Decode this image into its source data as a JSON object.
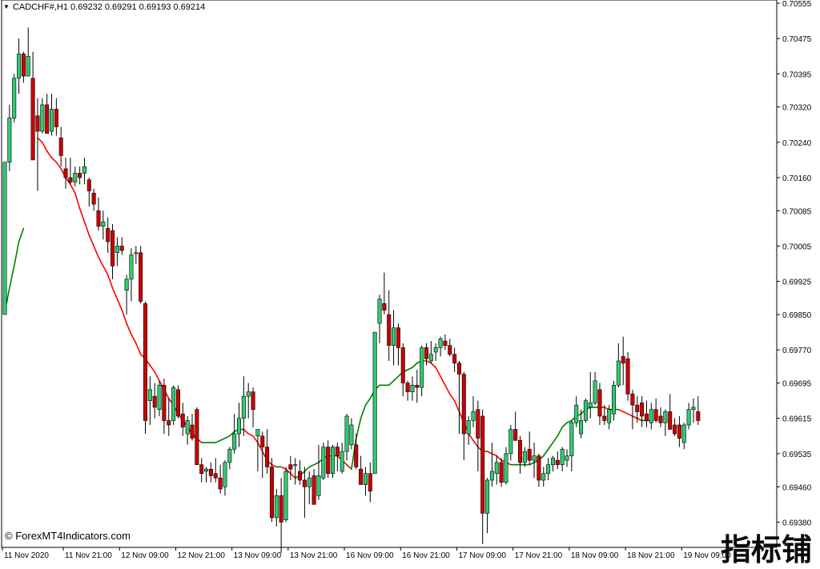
{
  "header": {
    "symbol_line": "CADCHF#,H1  0.69232 0.69291 0.69193 0.69214",
    "dropdown_icon": "triangle-down-icon"
  },
  "footer": {
    "copyright": "© ForexMT4Indicators.com",
    "watermark": "指标铺"
  },
  "colors": {
    "bull_candle": "#2ecc71",
    "bear_candle": "#cc0000",
    "wick": "#000000",
    "ma_up": "#008000",
    "ma_down": "#ff0000",
    "axis": "#000000",
    "background": "#ffffff"
  },
  "chart_data": {
    "type": "candlestick",
    "symbol": "CADCHF#",
    "timeframe": "H1",
    "ylim": [
      0.6933,
      0.70555
    ],
    "y_ticks": [
      "0.70555",
      "0.70475",
      "0.70395",
      "0.70320",
      "0.70240",
      "0.70160",
      "0.70085",
      "0.70005",
      "0.69925",
      "0.69850",
      "0.69770",
      "0.69695",
      "0.69615",
      "0.69535",
      "0.69460",
      "0.69380"
    ],
    "x_ticks": [
      {
        "label": "11 Nov 2020",
        "index": 0
      },
      {
        "label": "11 Nov 21:00",
        "index": 13
      },
      {
        "label": "12 Nov 09:00",
        "index": 25
      },
      {
        "label": "12 Nov 21:00",
        "index": 37
      },
      {
        "label": "13 Nov 09:00",
        "index": 49
      },
      {
        "label": "13 Nov 21:00",
        "index": 61
      },
      {
        "label": "16 Nov 09:00",
        "index": 73
      },
      {
        "label": "16 Nov 21:00",
        "index": 85
      },
      {
        "label": "17 Nov 09:00",
        "index": 97
      },
      {
        "label": "17 Nov 21:00",
        "index": 109
      },
      {
        "label": "18 Nov 09:00",
        "index": 121
      },
      {
        "label": "18 Nov 21:00",
        "index": 133
      },
      {
        "label": "19 Nov 09:00",
        "index": 145
      }
    ],
    "ohlc": [
      [
        0.6985,
        0.6988,
        0.6988,
        0.70195
      ],
      [
        0.70195,
        0.70325,
        0.70175,
        0.70295
      ],
      [
        0.70295,
        0.70395,
        0.70285,
        0.70385
      ],
      [
        0.70385,
        0.70475,
        0.7035,
        0.7044
      ],
      [
        0.7044,
        0.70445,
        0.70375,
        0.7039
      ],
      [
        0.7039,
        0.705,
        0.70395,
        0.70435
      ],
      [
        0.70385,
        0.70445,
        0.7021,
        0.702
      ],
      [
        0.703,
        0.7034,
        0.7013,
        0.70265
      ],
      [
        0.70265,
        0.7034,
        0.7026,
        0.70325
      ],
      [
        0.70325,
        0.7035,
        0.70275,
        0.7026
      ],
      [
        0.70265,
        0.7035,
        0.70255,
        0.70315
      ],
      [
        0.70315,
        0.7034,
        0.70255,
        0.70275
      ],
      [
        0.7025,
        0.70275,
        0.70185,
        0.7021
      ],
      [
        0.7018,
        0.70205,
        0.70135,
        0.7016
      ],
      [
        0.7016,
        0.70205,
        0.70145,
        0.7015
      ],
      [
        0.7015,
        0.70185,
        0.7014,
        0.7017
      ],
      [
        0.7017,
        0.70185,
        0.70145,
        0.7016
      ],
      [
        0.7017,
        0.70205,
        0.70145,
        0.70185
      ],
      [
        0.70155,
        0.7016,
        0.70095,
        0.7013
      ],
      [
        0.70125,
        0.70135,
        0.70085,
        0.701
      ],
      [
        0.70085,
        0.70115,
        0.7004,
        0.7005
      ],
      [
        0.7005,
        0.70085,
        0.7002,
        0.7006
      ],
      [
        0.70045,
        0.7007,
        0.6999,
        0.70015
      ],
      [
        0.7004,
        0.70055,
        0.6993,
        0.6996
      ],
      [
        0.6999,
        0.70025,
        0.6996,
        0.70005
      ],
      [
        0.70005,
        0.70025,
        0.69985,
        0.69995
      ],
      [
        0.69905,
        0.6994,
        0.6985,
        0.6993
      ],
      [
        0.6993,
        0.7,
        0.6988,
        0.69985
      ],
      [
        0.6999,
        0.70005,
        0.69965,
        0.6999
      ],
      [
        0.6999,
        0.70005,
        0.69875,
        0.6988
      ],
      [
        0.69875,
        0.6988,
        0.6958,
        0.6961
      ],
      [
        0.69655,
        0.6971,
        0.696,
        0.6968
      ],
      [
        0.69665,
        0.69695,
        0.69615,
        0.6964
      ],
      [
        0.69635,
        0.697,
        0.6962,
        0.6969
      ],
      [
        0.6969,
        0.69705,
        0.6958,
        0.6961
      ],
      [
        0.6961,
        0.6966,
        0.69575,
        0.696
      ],
      [
        0.6961,
        0.6969,
        0.696,
        0.69685
      ],
      [
        0.6968,
        0.6969,
        0.69615,
        0.6962
      ],
      [
        0.69625,
        0.6965,
        0.69575,
        0.69595
      ],
      [
        0.6958,
        0.6962,
        0.69555,
        0.6961
      ],
      [
        0.696,
        0.69625,
        0.69565,
        0.6957
      ],
      [
        0.69635,
        0.6964,
        0.6951,
        0.6951
      ],
      [
        0.6951,
        0.69525,
        0.6947,
        0.6949
      ],
      [
        0.69495,
        0.69505,
        0.6947,
        0.695
      ],
      [
        0.695,
        0.69515,
        0.6947,
        0.69485
      ],
      [
        0.6949,
        0.69525,
        0.6947,
        0.6948
      ],
      [
        0.6948,
        0.6951,
        0.69445,
        0.69455
      ],
      [
        0.6946,
        0.6952,
        0.6944,
        0.69515
      ],
      [
        0.69515,
        0.6955,
        0.695,
        0.69545
      ],
      [
        0.69545,
        0.69625,
        0.69535,
        0.6958
      ],
      [
        0.6958,
        0.6965,
        0.6955,
        0.69615
      ],
      [
        0.69615,
        0.6971,
        0.69575,
        0.69665
      ],
      [
        0.69665,
        0.69695,
        0.69615,
        0.69675
      ],
      [
        0.69675,
        0.69685,
        0.69595,
        0.69635
      ],
      [
        0.69575,
        0.69585,
        0.69495,
        0.6959
      ],
      [
        0.69575,
        0.69585,
        0.6948,
        0.6955
      ],
      [
        0.6955,
        0.6959,
        0.6949,
        0.69505
      ],
      [
        0.69505,
        0.69525,
        0.6938,
        0.6939
      ],
      [
        0.6939,
        0.69455,
        0.6937,
        0.6944
      ],
      [
        0.6944,
        0.6948,
        0.6931,
        0.6938
      ],
      [
        0.69385,
        0.69505,
        0.6938,
        0.69495
      ],
      [
        0.6951,
        0.6953,
        0.69475,
        0.695
      ],
      [
        0.6951,
        0.69525,
        0.69465,
        0.6951
      ],
      [
        0.69495,
        0.6952,
        0.69465,
        0.69475
      ],
      [
        0.69475,
        0.69505,
        0.6939,
        0.6946
      ],
      [
        0.6946,
        0.69495,
        0.6942,
        0.6948
      ],
      [
        0.69485,
        0.695,
        0.6943,
        0.6942
      ],
      [
        0.6944,
        0.69555,
        0.6943,
        0.69485
      ],
      [
        0.6948,
        0.6956,
        0.69475,
        0.6955
      ],
      [
        0.6955,
        0.69565,
        0.6948,
        0.6949
      ],
      [
        0.6949,
        0.69555,
        0.6948,
        0.6955
      ],
      [
        0.6955,
        0.6956,
        0.69495,
        0.6953
      ],
      [
        0.69495,
        0.6956,
        0.6949,
        0.6954
      ],
      [
        0.6954,
        0.69625,
        0.6952,
        0.6962
      ],
      [
        0.69555,
        0.69615,
        0.69545,
        0.696
      ],
      [
        0.69555,
        0.6958,
        0.695,
        0.69505
      ],
      [
        0.695,
        0.6953,
        0.69465,
        0.69465
      ],
      [
        0.69465,
        0.69505,
        0.6944,
        0.6949
      ],
      [
        0.6949,
        0.69515,
        0.69425,
        0.6945
      ],
      [
        0.6949,
        0.6979,
        0.69495,
        0.6981
      ],
      [
        0.6983,
        0.69895,
        0.69785,
        0.69885
      ],
      [
        0.69875,
        0.69945,
        0.6985,
        0.6986
      ],
      [
        0.6985,
        0.69905,
        0.69745,
        0.6978
      ],
      [
        0.6978,
        0.6986,
        0.69735,
        0.6982
      ],
      [
        0.6982,
        0.6983,
        0.69735,
        0.69775
      ],
      [
        0.69775,
        0.69785,
        0.69665,
        0.69695
      ],
      [
        0.69695,
        0.697,
        0.69655,
        0.69675
      ],
      [
        0.69675,
        0.6971,
        0.69655,
        0.6969
      ],
      [
        0.6969,
        0.69725,
        0.6965,
        0.69685
      ],
      [
        0.69685,
        0.6978,
        0.69665,
        0.69775
      ],
      [
        0.69775,
        0.69785,
        0.69735,
        0.6975
      ],
      [
        0.69745,
        0.6979,
        0.6974,
        0.6976
      ],
      [
        0.69765,
        0.69785,
        0.69745,
        0.69775
      ],
      [
        0.69775,
        0.698,
        0.69755,
        0.69795
      ],
      [
        0.6979,
        0.69805,
        0.6977,
        0.6978
      ],
      [
        0.6978,
        0.69795,
        0.69755,
        0.6976
      ],
      [
        0.6976,
        0.69775,
        0.6972,
        0.6974
      ],
      [
        0.6974,
        0.69745,
        0.6958,
        0.69715
      ],
      [
        0.69715,
        0.6972,
        0.6952,
        0.6958
      ],
      [
        0.6958,
        0.6962,
        0.69555,
        0.6961
      ],
      [
        0.6961,
        0.69665,
        0.69595,
        0.6963
      ],
      [
        0.69635,
        0.69655,
        0.69495,
        0.6957
      ],
      [
        0.6962,
        0.69635,
        0.6933,
        0.694
      ],
      [
        0.694,
        0.6948,
        0.69355,
        0.69475
      ],
      [
        0.69475,
        0.6956,
        0.6946,
        0.69495
      ],
      [
        0.6949,
        0.6953,
        0.69465,
        0.69515
      ],
      [
        0.69515,
        0.69525,
        0.6946,
        0.6947
      ],
      [
        0.6947,
        0.6955,
        0.69465,
        0.69535
      ],
      [
        0.69535,
        0.696,
        0.6952,
        0.6959
      ],
      [
        0.6959,
        0.6963,
        0.6957,
        0.69565
      ],
      [
        0.69565,
        0.69575,
        0.6949,
        0.69515
      ],
      [
        0.69515,
        0.6955,
        0.69505,
        0.6954
      ],
      [
        0.69545,
        0.69585,
        0.6951,
        0.6952
      ],
      [
        0.6952,
        0.6956,
        0.6948,
        0.6953
      ],
      [
        0.6953,
        0.69535,
        0.6946,
        0.69475
      ],
      [
        0.69475,
        0.69505,
        0.6946,
        0.6949
      ],
      [
        0.6949,
        0.69525,
        0.69475,
        0.6951
      ],
      [
        0.6951,
        0.6953,
        0.69495,
        0.69525
      ],
      [
        0.6952,
        0.6954,
        0.695,
        0.6951
      ],
      [
        0.6951,
        0.6955,
        0.69495,
        0.69545
      ],
      [
        0.6952,
        0.69545,
        0.69505,
        0.6953
      ],
      [
        0.6953,
        0.6961,
        0.69495,
        0.69605
      ],
      [
        0.69605,
        0.69665,
        0.69595,
        0.69645
      ],
      [
        0.6958,
        0.69635,
        0.6957,
        0.6961
      ],
      [
        0.6961,
        0.6966,
        0.69605,
        0.69655
      ],
      [
        0.6964,
        0.6972,
        0.69615,
        0.6965
      ],
      [
        0.6965,
        0.6972,
        0.69645,
        0.697
      ],
      [
        0.6968,
        0.69695,
        0.696,
        0.6962
      ],
      [
        0.6962,
        0.69645,
        0.696,
        0.6961
      ],
      [
        0.69605,
        0.69645,
        0.6959,
        0.69635
      ],
      [
        0.69625,
        0.697,
        0.6961,
        0.6969
      ],
      [
        0.6969,
        0.69785,
        0.69685,
        0.69745
      ],
      [
        0.69755,
        0.698,
        0.6969,
        0.6974
      ],
      [
        0.6975,
        0.69765,
        0.69655,
        0.6967
      ],
      [
        0.6967,
        0.6968,
        0.6959,
        0.69645
      ],
      [
        0.69645,
        0.69665,
        0.69605,
        0.6963
      ],
      [
        0.6965,
        0.69665,
        0.69595,
        0.6962
      ],
      [
        0.69625,
        0.69655,
        0.69595,
        0.6961
      ],
      [
        0.69605,
        0.6965,
        0.6959,
        0.69635
      ],
      [
        0.69635,
        0.6966,
        0.69605,
        0.6961
      ],
      [
        0.6962,
        0.6964,
        0.69595,
        0.69605
      ],
      [
        0.69605,
        0.69635,
        0.69575,
        0.6963
      ],
      [
        0.6963,
        0.6967,
        0.696,
        0.6959
      ],
      [
        0.696,
        0.69615,
        0.69575,
        0.6958
      ],
      [
        0.696,
        0.6962,
        0.6955,
        0.6957
      ],
      [
        0.6956,
        0.69605,
        0.69545,
        0.696
      ],
      [
        0.696,
        0.6965,
        0.6959,
        0.69635
      ],
      [
        0.69635,
        0.6966,
        0.69605,
        0.6964
      ],
      [
        0.6963,
        0.69665,
        0.696,
        0.6961
      ]
    ],
    "ma": [
      0.69855,
      0.6991,
      0.6996,
      0.70015,
      0.70045,
      null,
      null,
      0.7025,
      0.7024,
      0.7022,
      0.70205,
      0.70195,
      0.7018,
      0.7016,
      0.70145,
      0.70125,
      0.7009,
      0.7006,
      0.7003,
      0.70005,
      0.6998,
      0.6996,
      0.6994,
      0.6991,
      0.69885,
      0.6986,
      0.6983,
      0.69805,
      0.69785,
      0.6976,
      0.6975,
      0.69735,
      0.6972,
      0.697,
      0.6968,
      0.6966,
      0.69645,
      0.69625,
      0.6961,
      0.69595,
      0.6958,
      0.6957,
      0.6956,
      0.6956,
      0.6956,
      0.6956,
      0.69565,
      0.6957,
      0.69575,
      0.69585,
      0.6959,
      0.6959,
      0.6958,
      0.69575,
      0.6956,
      0.6954,
      0.6952,
      0.6951,
      0.69505,
      0.69505,
      0.695,
      0.6949,
      0.6948,
      0.69485,
      0.69495,
      0.69505,
      0.6951,
      0.69515,
      0.69525,
      0.6953,
      0.6953,
      0.6953,
      0.6952,
      0.6951,
      0.695,
      0.6957,
      0.69615,
      0.69645,
      0.6966,
      0.6968,
      0.6969,
      0.6969,
      0.6969,
      0.697,
      0.6971,
      0.6972,
      0.69725,
      0.6973,
      0.6974,
      0.69745,
      0.69745,
      0.6974,
      0.6973,
      0.6971,
      0.6969,
      0.6967,
      0.69655,
      0.6963,
      0.69605,
      0.6958,
      0.69565,
      0.6955,
      0.6954,
      0.6954,
      0.69535,
      0.6953,
      0.6952,
      0.69515,
      0.6951,
      0.6951,
      0.6951,
      0.6951,
      0.6951,
      0.69515,
      0.6952,
      0.6953,
      0.69545,
      0.6956,
      0.69575,
      0.69595,
      0.69605,
      0.6961,
      0.6962,
      0.69625,
      0.69635,
      0.6964,
      0.6964,
      0.6964,
      0.6964,
      0.69635,
      0.69635,
      0.69635,
      0.6963,
      0.69625,
      0.6962,
      0.69615,
      0.6961,
      0.6961,
      0.6961
    ]
  }
}
